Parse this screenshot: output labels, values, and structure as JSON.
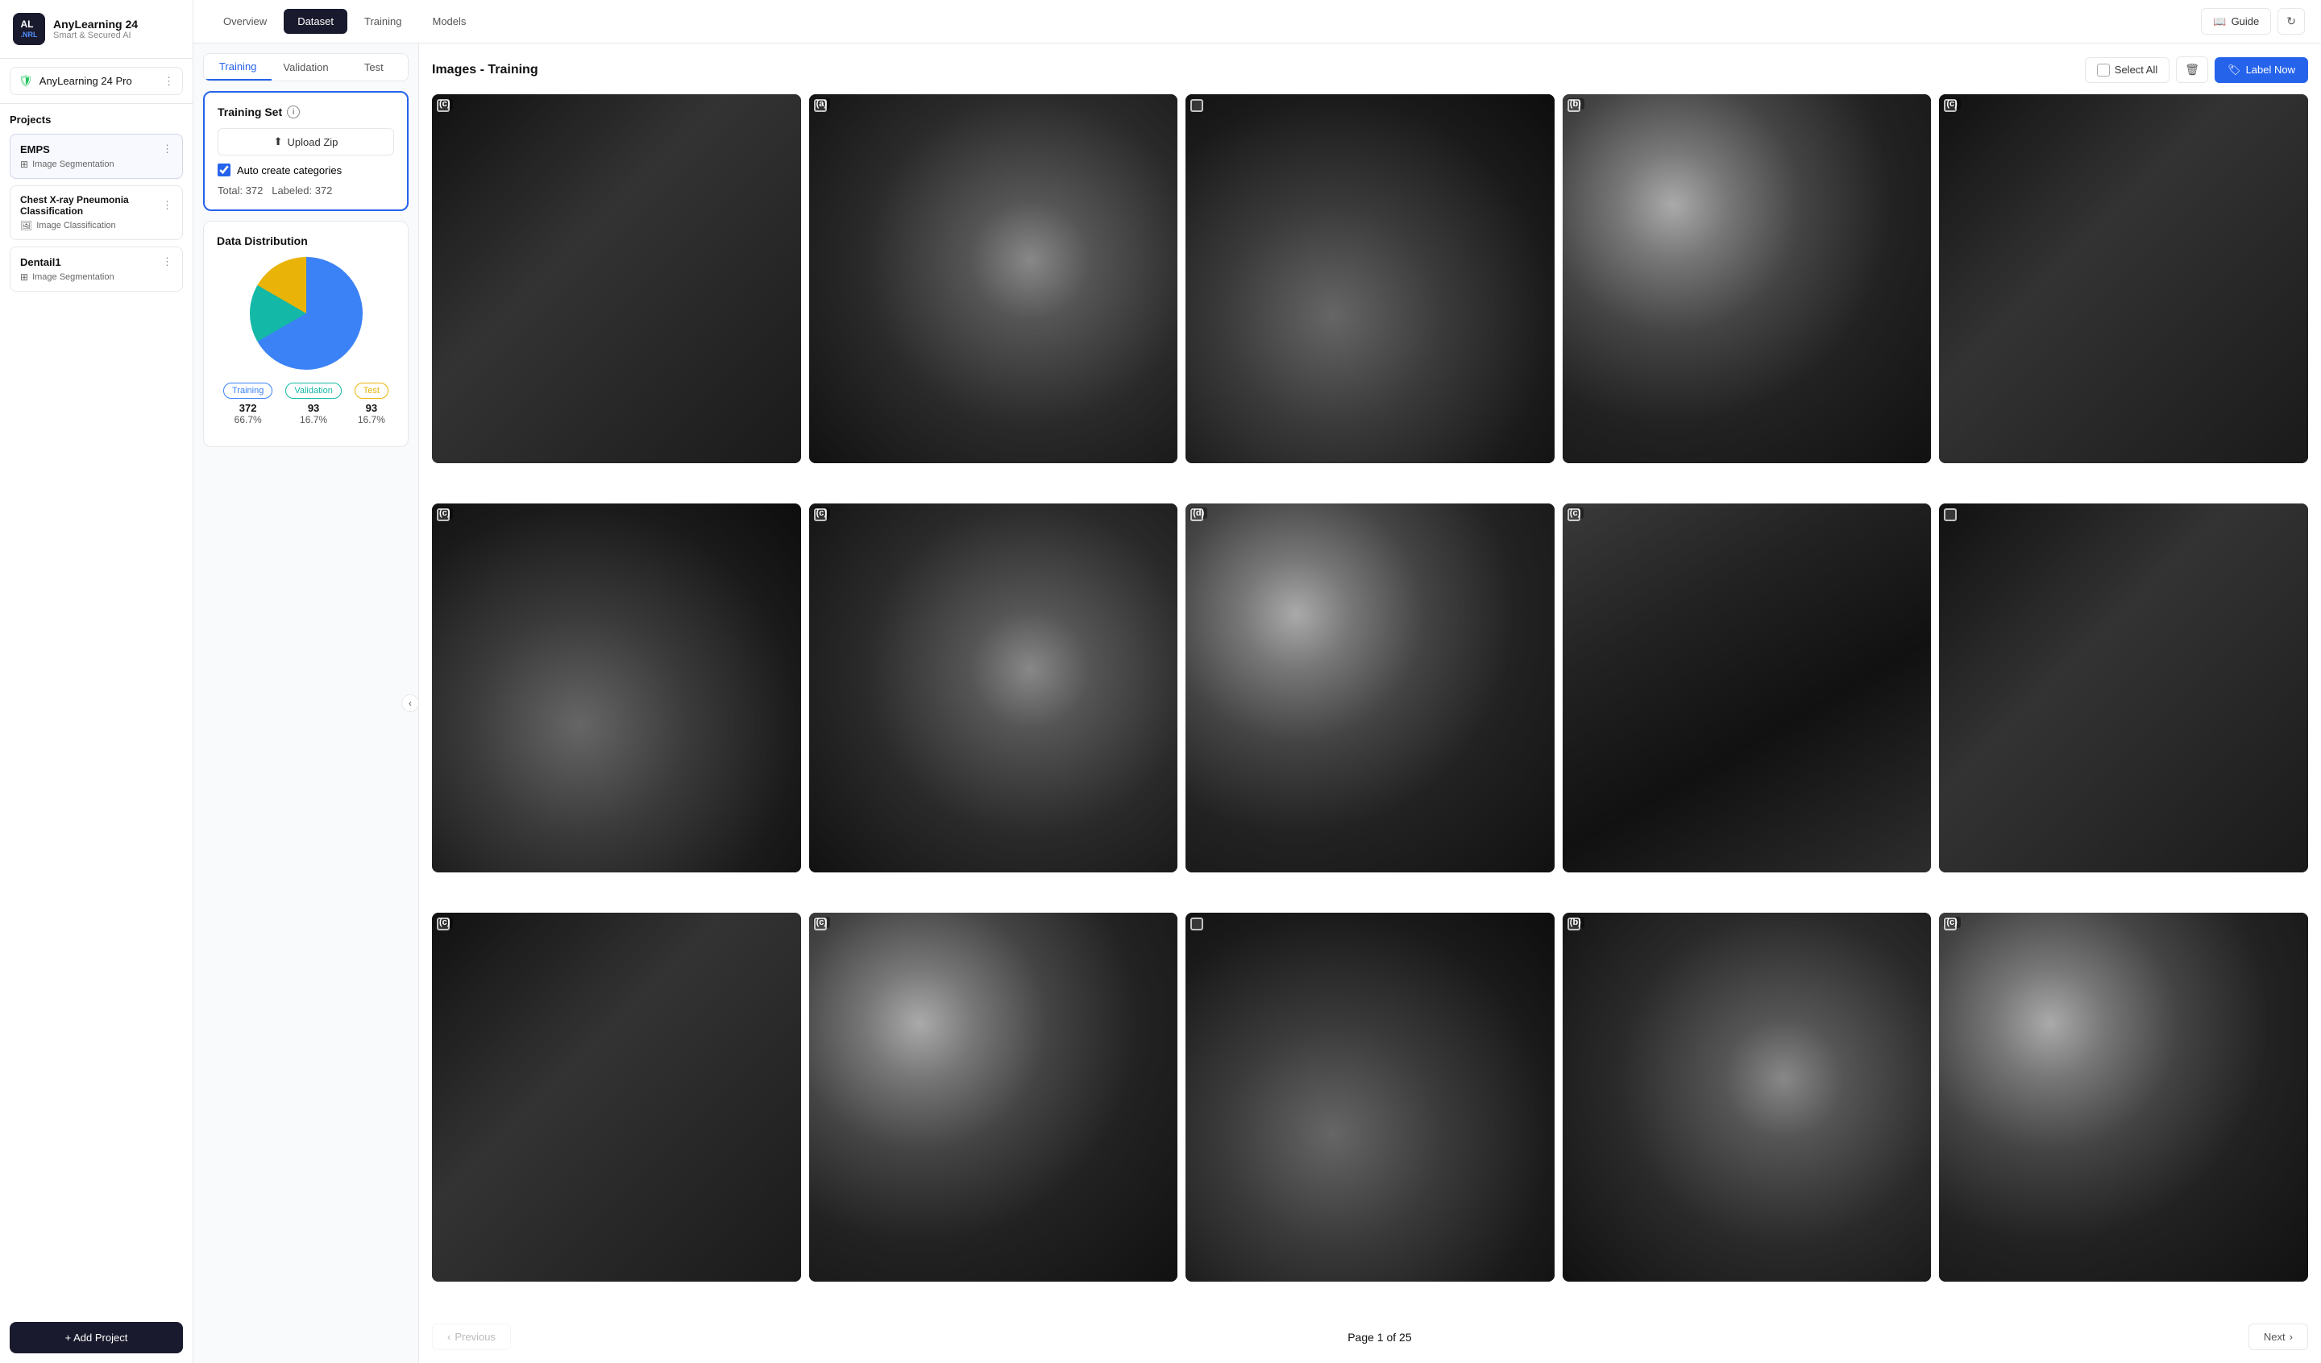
{
  "app": {
    "logo": "AL\n.NRL",
    "name": "AnyLearning 24",
    "subtitle": "Smart & Secured AI"
  },
  "workspace": {
    "name": "AnyLearning 24 Pro"
  },
  "projects": {
    "title": "Projects",
    "items": [
      {
        "id": 1,
        "name": "EMPS",
        "type": "Image Segmentation",
        "active": true
      },
      {
        "id": 2,
        "name": "Chest X-ray Pneumonia Classification",
        "type": "Image Classification",
        "active": false
      },
      {
        "id": 3,
        "name": "Dentail1",
        "type": "Image Segmentation",
        "active": false
      }
    ],
    "add_label": "+ Add Project"
  },
  "top_tabs": [
    {
      "id": "overview",
      "label": "Overview",
      "active": false
    },
    {
      "id": "dataset",
      "label": "Dataset",
      "active": true
    },
    {
      "id": "training",
      "label": "Training",
      "active": false
    },
    {
      "id": "models",
      "label": "Models",
      "active": false
    }
  ],
  "header_actions": {
    "guide_label": "Guide",
    "refresh_icon": "↻"
  },
  "sub_tabs": [
    {
      "id": "training",
      "label": "Training",
      "active": true
    },
    {
      "id": "validation",
      "label": "Validation",
      "active": false
    },
    {
      "id": "test",
      "label": "Test",
      "active": false
    }
  ],
  "training_set": {
    "title": "Training Set",
    "upload_label": "Upload Zip",
    "auto_create": "Auto create categories",
    "auto_create_checked": true,
    "total_label": "Total: 372",
    "labeled_label": "Labeled: 372"
  },
  "distribution": {
    "title": "Data Distribution",
    "legend": [
      {
        "label": "Training",
        "count": "372",
        "pct": "66.7%",
        "type": "training"
      },
      {
        "label": "Validation",
        "count": "93",
        "pct": "16.7%",
        "type": "validation"
      },
      {
        "label": "Test",
        "count": "93",
        "pct": "16.7%",
        "type": "test"
      }
    ]
  },
  "images_panel": {
    "title": "Images - Training",
    "select_all_label": "Select All",
    "label_now_label": "Label Now",
    "page_info": "Page 1 of 25",
    "prev_label": "Previous",
    "next_label": "Next"
  },
  "images": [
    {
      "filename": "7a48f5b4d5.png",
      "status": "Labeled",
      "letter": "c",
      "style": "dark"
    },
    {
      "filename": "aa968ec1b2.png",
      "status": "Labeled",
      "letter": "a",
      "style": "micro1"
    },
    {
      "filename": "9c9d1af243.png",
      "status": "Labeled",
      "letter": "",
      "style": "micro2"
    },
    {
      "filename": "7c5501d292.png",
      "status": "Labeled",
      "letter": "b",
      "style": "spheres"
    },
    {
      "filename": "62e729e838.png",
      "status": "Labeled",
      "letter": "c",
      "style": "dark"
    },
    {
      "filename": "a492171fa8.png",
      "status": "Labeled",
      "letter": "c",
      "style": "micro2"
    },
    {
      "filename": "296a52bf09.png",
      "status": "Labeled",
      "letter": "c",
      "style": "micro1"
    },
    {
      "filename": "1cb46bfdd5.png",
      "status": "Labeled",
      "letter": "d",
      "style": "spheres"
    },
    {
      "filename": "99eb4bad25.png",
      "status": "Labeled",
      "letter": "c",
      "style": "tube"
    },
    {
      "filename": "671b7c8831.png",
      "status": "Labeled",
      "letter": "",
      "style": "dark"
    },
    {
      "filename": "f7f7093f0f.png",
      "status": "Labeled",
      "letter": "c",
      "style": "dark"
    },
    {
      "filename": "a68915823c.png",
      "status": "Labeled",
      "letter": "c",
      "style": "spheres"
    },
    {
      "filename": "923cab32ee.png",
      "status": "Labeled",
      "letter": "",
      "style": "micro2"
    },
    {
      "filename": "e853d120fa.png",
      "status": "Labeled",
      "letter": "b",
      "style": "micro1"
    },
    {
      "filename": "434e287439.png",
      "status": "Labeled",
      "letter": "c",
      "style": "spheres"
    }
  ]
}
